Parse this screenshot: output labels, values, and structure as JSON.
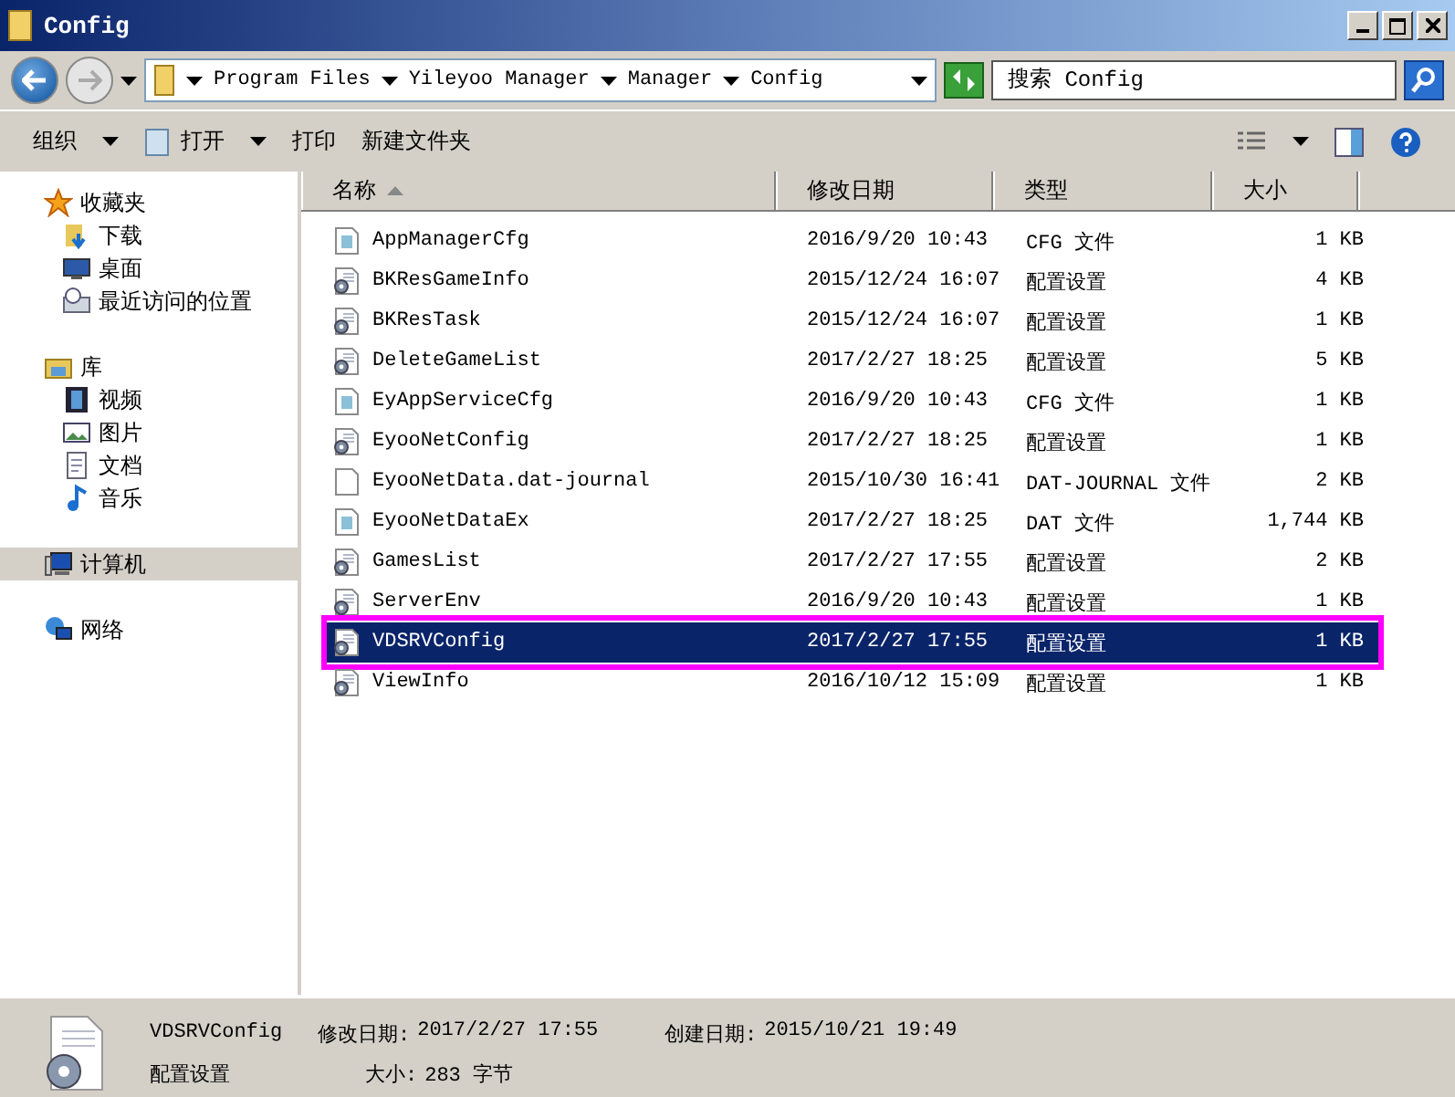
{
  "window": {
    "title": "Config"
  },
  "address": {
    "path": [
      {
        "label": "Program Files"
      },
      {
        "label": "Yileyoo Manager"
      },
      {
        "label": "Manager"
      },
      {
        "label": "Config"
      }
    ]
  },
  "search": {
    "placeholder": "搜索 Config"
  },
  "toolbar": [
    {
      "label": "组织",
      "kind": "menu"
    },
    {
      "label": "打开",
      "kind": "open"
    },
    {
      "label": "打印",
      "kind": "plain"
    },
    {
      "label": "新建文件夹",
      "kind": "plain"
    }
  ],
  "sidebar": [
    {
      "label": "收藏夹",
      "kind": "star",
      "selected": false,
      "children": [
        {
          "label": "下载",
          "kind": "download",
          "selected": false
        },
        {
          "label": "桌面",
          "kind": "desktop",
          "selected": false
        },
        {
          "label": "最近访问的位置",
          "kind": "recent",
          "selected": false
        }
      ]
    },
    {
      "label": "库",
      "kind": "library",
      "selected": false,
      "children": [
        {
          "label": "视频",
          "kind": "video",
          "selected": false
        },
        {
          "label": "图片",
          "kind": "image",
          "selected": false
        },
        {
          "label": "文档",
          "kind": "doc",
          "selected": false
        },
        {
          "label": "音乐",
          "kind": "music",
          "selected": false
        }
      ]
    },
    {
      "label": "计算机",
      "kind": "computer",
      "selected": true
    },
    {
      "label": "网络",
      "kind": "network",
      "selected": false
    }
  ],
  "table": {
    "columns": [
      {
        "label": "名称",
        "sorted": true
      },
      {
        "label": "修改日期",
        "sorted": false
      },
      {
        "label": "类型",
        "sorted": false
      },
      {
        "label": "大小",
        "sorted": false
      }
    ],
    "rows": [
      {
        "name": "AppManagerCfg",
        "date": "2016/9/20 10:43",
        "type": "CFG 文件",
        "size": "1 KB",
        "kind": "cfg",
        "selected": false
      },
      {
        "name": "BKResGameInfo",
        "date": "2015/12/24 16:07",
        "type": "配置设置",
        "size": "4 KB",
        "kind": "settings",
        "selected": false
      },
      {
        "name": "BKResTask",
        "date": "2015/12/24 16:07",
        "type": "配置设置",
        "size": "1 KB",
        "kind": "settings",
        "selected": false
      },
      {
        "name": "DeleteGameList",
        "date": "2017/2/27 18:25",
        "type": "配置设置",
        "size": "5 KB",
        "kind": "settings",
        "selected": false
      },
      {
        "name": "EyAppServiceCfg",
        "date": "2016/9/20 10:43",
        "type": "CFG 文件",
        "size": "1 KB",
        "kind": "cfg",
        "selected": false
      },
      {
        "name": "EyooNetConfig",
        "date": "2017/2/27 18:25",
        "type": "配置设置",
        "size": "1 KB",
        "kind": "settings",
        "selected": false
      },
      {
        "name": "EyooNetData.dat-journal",
        "date": "2015/10/30 16:41",
        "type": "DAT-JOURNAL 文件",
        "size": "2 KB",
        "kind": "blank",
        "selected": false
      },
      {
        "name": "EyooNetDataEx",
        "date": "2017/2/27 18:25",
        "type": "DAT 文件",
        "size": "1,744 KB",
        "kind": "cfg",
        "selected": false
      },
      {
        "name": "GamesList",
        "date": "2017/2/27 17:55",
        "type": "配置设置",
        "size": "2 KB",
        "kind": "settings",
        "selected": false
      },
      {
        "name": "ServerEnv",
        "date": "2016/9/20 10:43",
        "type": "配置设置",
        "size": "1 KB",
        "kind": "settings",
        "selected": false
      },
      {
        "name": "VDSRVConfig",
        "date": "2017/2/27 17:55",
        "type": "配置设置",
        "size": "1 KB",
        "kind": "settings",
        "selected": true,
        "annotated": true
      },
      {
        "name": "ViewInfo",
        "date": "2016/10/12 15:09",
        "type": "配置设置",
        "size": "1 KB",
        "kind": "settings",
        "selected": false
      }
    ]
  },
  "details": {
    "name": "VDSRVConfig",
    "type": "配置设置",
    "modified_label": "修改日期:",
    "modified": "2017/2/27 17:55",
    "size_label": "大小:",
    "size": "283 字节",
    "created_label": "创建日期:",
    "created": "2015/10/21 19:49"
  }
}
